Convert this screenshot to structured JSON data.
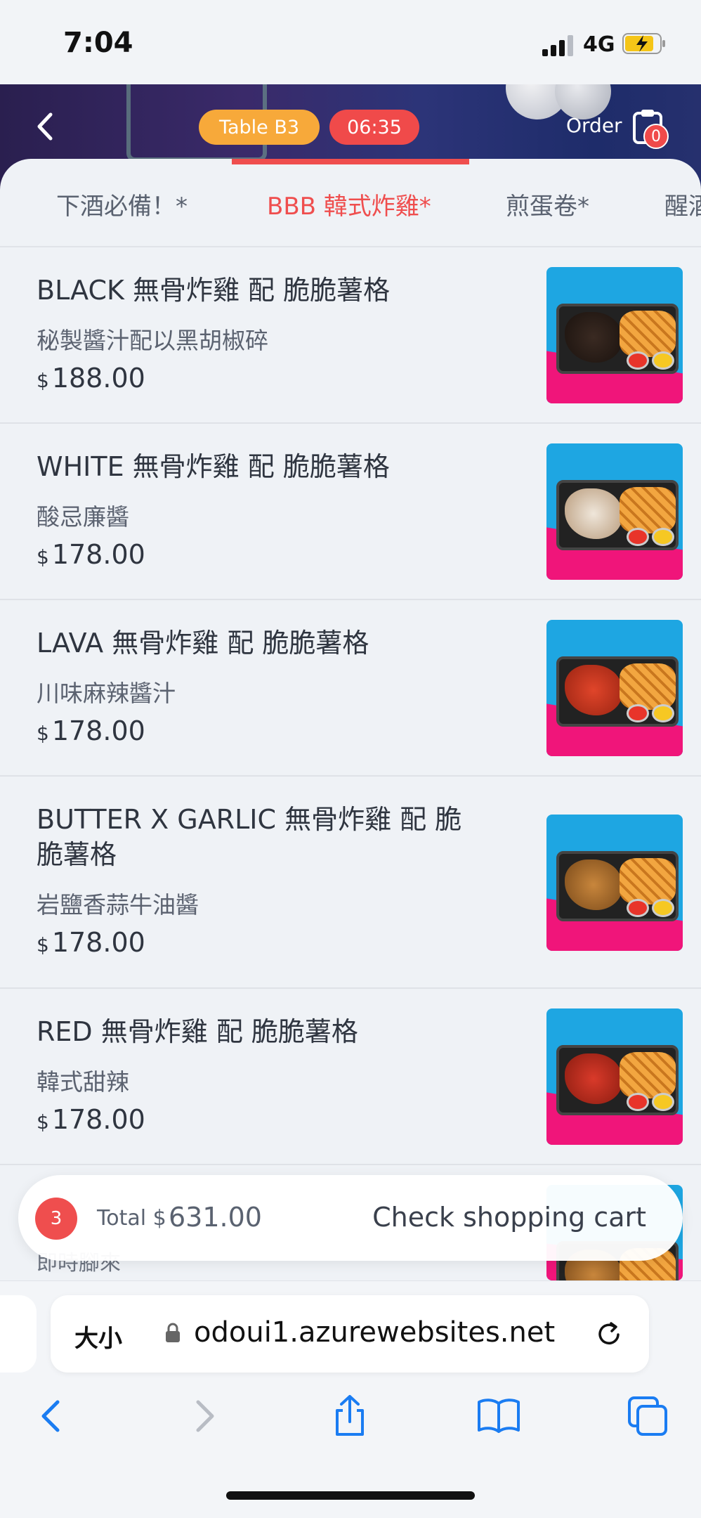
{
  "status_bar": {
    "time": "7:04",
    "network": "4G"
  },
  "header": {
    "table_label": "Table  B3",
    "timer": "06:35",
    "order_label": "Order",
    "order_count": "0"
  },
  "tabs": [
    {
      "label": "下酒必備！*",
      "active": false
    },
    {
      "label": "BBB 韓式炸雞*",
      "active": true
    },
    {
      "label": "煎蛋卷*",
      "active": false
    },
    {
      "label": "醒酒",
      "active": false
    }
  ],
  "menu_items": [
    {
      "name": "BLACK 無骨炸雞 配 脆脆薯格",
      "description": "秘製醬汁配以黑胡椒碎",
      "currency": "$",
      "price": "188.00",
      "sauce": "black"
    },
    {
      "name": "WHITE 無骨炸雞 配 脆脆薯格",
      "description": "酸忌廉醬",
      "currency": "$",
      "price": "178.00",
      "sauce": "white"
    },
    {
      "name": "LAVA 無骨炸雞 配 脆脆薯格",
      "description": "川味麻辣醬汁",
      "currency": "$",
      "price": "178.00",
      "sauce": "red"
    },
    {
      "name": "BUTTER X GARLIC 無骨炸雞 配 脆脆薯格",
      "description": "岩鹽香蒜牛油醬",
      "currency": "$",
      "price": "178.00",
      "sauce": "golden"
    },
    {
      "name": "RED 無骨炸雞 配 脆脆薯格",
      "description": "韓式甜辣",
      "currency": "$",
      "price": "178.00",
      "sauce": "red"
    }
  ],
  "partial_item_desc": "即時腳來",
  "cart": {
    "count": "3",
    "total_label": "Total $",
    "total_value": "631.00",
    "check_label": "Check shopping cart"
  },
  "browser": {
    "text_size_label": "大小",
    "url": "odoui1.azurewebsites.net"
  },
  "colors": {
    "accent": "#ef4e4e",
    "table_pill": "#f7a93a",
    "photo_blue": "#1ea6e2",
    "photo_pink": "#f0157a"
  }
}
